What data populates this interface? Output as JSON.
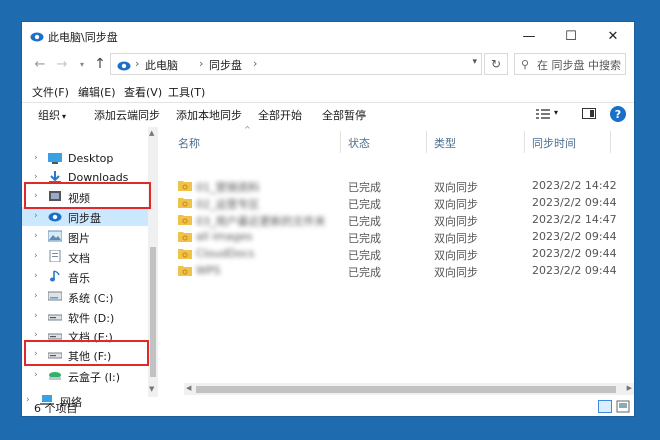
{
  "window": {
    "title": "此电脑\\同步盘",
    "minimize": "—",
    "maximize": "☐",
    "close": "✕"
  },
  "nav_buttons": {
    "back": "←",
    "forward": "→",
    "recent": "▾",
    "up": "↑"
  },
  "address": {
    "items": [
      "此电脑",
      "同步盘"
    ],
    "separator": "›",
    "dropdown": "▾",
    "refresh": "↻"
  },
  "search": {
    "icon": "⚲",
    "placeholder": "在 同步盘 中搜索"
  },
  "menu": [
    "文件(F)",
    "编辑(E)",
    "查看(V)",
    "工具(T)"
  ],
  "toolbar": {
    "organize": "组织",
    "organize_caret": "▾",
    "items": [
      "添加云端同步",
      "添加本地同步",
      "全部开始",
      "全部暂停"
    ],
    "view_caret": "▾",
    "help": "?"
  },
  "sidebar": {
    "items": [
      {
        "label": "Desktop",
        "icon": "desktop-icon"
      },
      {
        "label": "Downloads",
        "icon": "downloads-icon"
      },
      {
        "label": "视频",
        "icon": "video-icon"
      },
      {
        "label": "同步盘",
        "icon": "sync-cloud-icon",
        "selected": true
      },
      {
        "label": "图片",
        "icon": "pictures-icon"
      },
      {
        "label": "文档",
        "icon": "documents-icon"
      },
      {
        "label": "音乐",
        "icon": "music-icon"
      },
      {
        "label": "系统 (C:)",
        "icon": "drive-icon"
      },
      {
        "label": "软件 (D:)",
        "icon": "drive-icon"
      },
      {
        "label": "文档 (E:)",
        "icon": "drive-icon"
      },
      {
        "label": "其他 (F:)",
        "icon": "drive-icon"
      },
      {
        "label": "云盒子 (I:)",
        "icon": "cloud-drive-icon"
      }
    ],
    "network": {
      "label": "网络",
      "icon": "network-icon"
    },
    "chevron": "›",
    "colors": {
      "selected_bg": "#cce8ff",
      "highlight_border": "#e02a2a"
    }
  },
  "columns": [
    "名称",
    "状态",
    "类型",
    "同步时间"
  ],
  "files": [
    {
      "name": "01_营销资料",
      "status": "已完成",
      "type": "双向同步",
      "time": "2023/2/2 14:42"
    },
    {
      "name": "02_运营专区",
      "status": "已完成",
      "type": "双向同步",
      "time": "2023/2/2 09:44"
    },
    {
      "name": "03_用户最近更新的文件夹",
      "status": "已完成",
      "type": "双向同步",
      "time": "2023/2/2 14:47"
    },
    {
      "name": "all images",
      "status": "已完成",
      "type": "双向同步",
      "time": "2023/2/2 09:44"
    },
    {
      "name": "CloudDocs",
      "status": "已完成",
      "type": "双向同步",
      "time": "2023/2/2 09:44"
    },
    {
      "name": "WPS",
      "status": "已完成",
      "type": "双向同步",
      "time": "2023/2/2 09:44"
    }
  ],
  "status_bar": {
    "count": "6 个项目"
  },
  "colors": {
    "accent": "#1a6fc9",
    "background": "#1e6bb0",
    "folder": "#f0c24b"
  }
}
